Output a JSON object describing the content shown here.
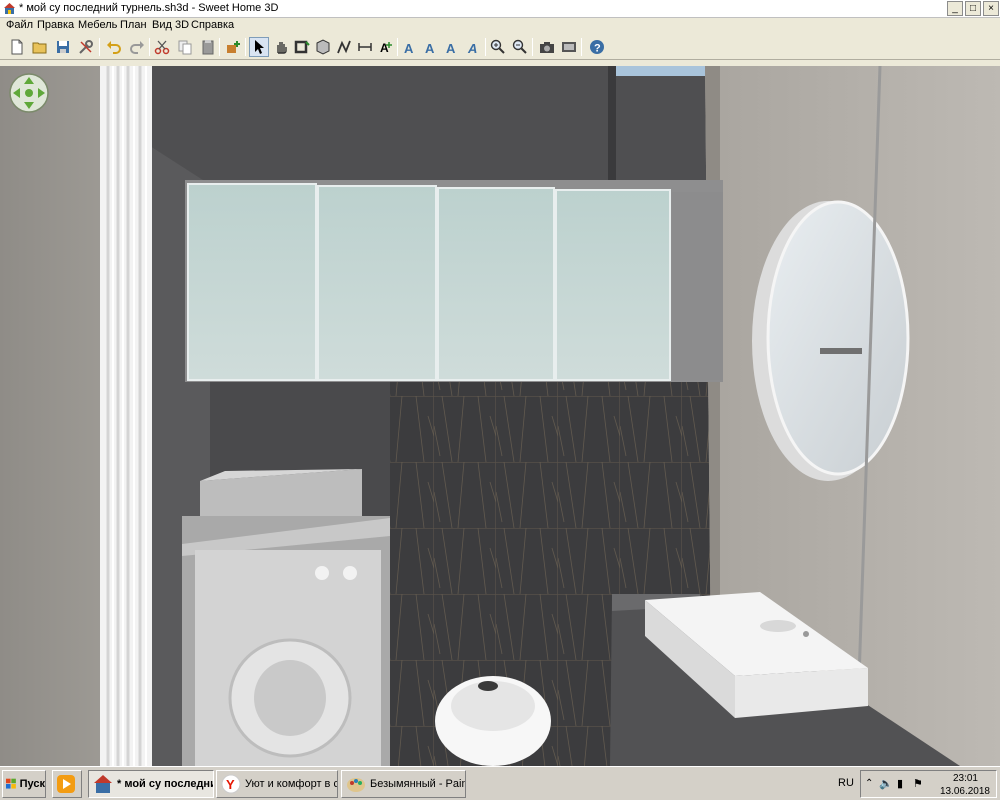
{
  "window": {
    "title": "* мой су последний турнель.sh3d - Sweet Home 3D",
    "controls": {
      "minimize": "_",
      "maximize": "□",
      "close": "×"
    }
  },
  "menu": {
    "items": [
      "Файл",
      "Правка",
      "Мебель",
      "План",
      "Вид 3D",
      "Справка"
    ]
  },
  "toolbar": {
    "buttons": [
      {
        "name": "new-home",
        "icon": "new-file-icon"
      },
      {
        "name": "open",
        "icon": "folder-open-icon"
      },
      {
        "name": "save",
        "icon": "save-icon"
      },
      {
        "name": "preferences",
        "icon": "tools-icon"
      },
      {
        "name": "undo",
        "icon": "undo-icon"
      },
      {
        "name": "redo",
        "icon": "redo-icon"
      },
      {
        "name": "cut",
        "icon": "scissors-icon"
      },
      {
        "name": "copy",
        "icon": "copy-icon"
      },
      {
        "name": "paste",
        "icon": "paste-icon"
      },
      {
        "name": "add-furniture",
        "icon": "add-furniture-icon"
      },
      {
        "name": "select-mode",
        "icon": "arrow-pointer-icon"
      },
      {
        "name": "pan-mode",
        "icon": "hand-icon"
      },
      {
        "name": "create-walls",
        "icon": "walls-icon"
      },
      {
        "name": "create-rooms",
        "icon": "rooms-icon"
      },
      {
        "name": "create-polylines",
        "icon": "polyline-icon"
      },
      {
        "name": "create-dimensions",
        "icon": "dimension-icon"
      },
      {
        "name": "add-text",
        "icon": "text-icon"
      },
      {
        "name": "text-style-1",
        "icon": "text-style-icon"
      },
      {
        "name": "text-style-2",
        "icon": "text-style-icon"
      },
      {
        "name": "text-style-3",
        "icon": "text-style-icon"
      },
      {
        "name": "text-style-4",
        "icon": "text-style-icon"
      },
      {
        "name": "zoom-in",
        "icon": "zoom-in-icon"
      },
      {
        "name": "zoom-out",
        "icon": "zoom-out-icon"
      },
      {
        "name": "create-photo",
        "icon": "camera-icon"
      },
      {
        "name": "create-video",
        "icon": "video-icon"
      },
      {
        "name": "help",
        "icon": "help-icon"
      }
    ]
  },
  "taskbar": {
    "start_label": "Пуск",
    "tasks": [
      {
        "label": "* мой су последни...",
        "active": true
      },
      {
        "label": "Уют и комфорт в с...",
        "active": false
      },
      {
        "label": "Безымянный - Paint",
        "active": false
      }
    ],
    "language": "RU",
    "time": "23:01",
    "date": "13.06.2018"
  },
  "colors": {
    "wall_dark": "#4d4d4f",
    "wall_concrete": "#9a9792",
    "cabinet_glass": "#c6d6d3",
    "tile_dark": "#3c3c3e",
    "accent_selected": "#7f9db9"
  }
}
